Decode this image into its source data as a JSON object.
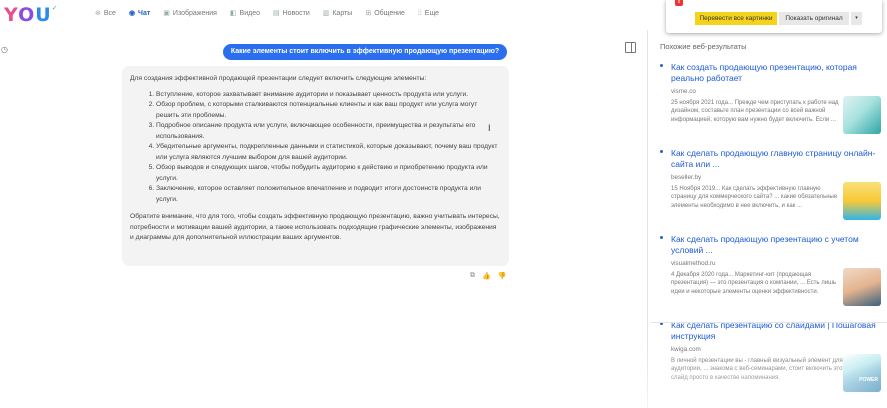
{
  "logo": {
    "text": "YOU"
  },
  "nav": [
    {
      "icon": "globe-icon",
      "glyph": "⊛",
      "label": "Все",
      "active": false
    },
    {
      "icon": "chat-icon",
      "glyph": "◉",
      "label": "Чат",
      "active": true
    },
    {
      "icon": "image-icon",
      "glyph": "▣",
      "label": "Изображения",
      "active": false
    },
    {
      "icon": "video-icon",
      "glyph": "◧",
      "label": "Видео",
      "active": false
    },
    {
      "icon": "news-icon",
      "glyph": "▤",
      "label": "Новости",
      "active": false
    },
    {
      "icon": "map-icon",
      "glyph": "▥",
      "label": "Карты",
      "active": false
    },
    {
      "icon": "community-icon",
      "glyph": "⊞",
      "label": "Общение",
      "active": false
    },
    {
      "icon": "more-icon",
      "glyph": "⁞⁞",
      "label": "Еще",
      "active": false
    }
  ],
  "translate": {
    "translate_all": "Перевести все картинки",
    "show_original": "Показать оригинал",
    "dropdown": "▾",
    "flag": "x"
  },
  "chat": {
    "question": "Какие элементы стоит включить в эффективную продающую презентацию?",
    "intro": "Для создания эффективной продающей презентации следует включить следующие элементы:",
    "items": [
      "Вступление, которое захватывает внимание аудитории и показывает ценность продукта или услуги.",
      "Обзор проблем, с которыми сталкиваются потенциальные клиенты и как ваш продукт или услуга могут решить эти проблемы.",
      "Подробное описание продукта или услуги, включающее особенности, преимущества и результаты его использования.",
      "Убедительные аргументы, подкрепленные данными и статистикой, которые доказывают, почему ваш продукт или услуга являются лучшим выбором для вашей аудитории.",
      "Обзор выводов и следующих шагов, чтобы побудить аудиторию к действию и приобретению продукта или услуги.",
      "Заключение, которое оставляет положительное впечатление и подводит итоги достоинств продукта или услуги."
    ],
    "outro": "Обратите внимание, что для того, чтобы создать эффективную продающую презентацию, важно учитывать интересы, потребности и мотивации вашей аудитории, а также использовать подходящие графические элементы, изображения и диаграммы для дополнительной иллюстрации ваших аргументов."
  },
  "feedback": {
    "copy": "⧉",
    "like": "👍",
    "dislike": "👎"
  },
  "related": {
    "heading": "Похожие веб-результаты",
    "results": [
      {
        "title": "Как создать продающую презентацию, которая реально работает",
        "domain": "visme.co",
        "snippet": "25 ноября 2021 года... Прежде чем приступать к работе над дизайном, составьте план презентации со всей важной информацией, которую вам нужно будет включить. Если ..."
      },
      {
        "title": "Как сделать продающую главную страницу онлайн-сайта или ...",
        "domain": "beseller.by",
        "snippet": "15 Ноября 2019... Как сделать эффективную главную страницу для коммерческого сайта? ... какие обязательные элементы необходимо в нее включить, и как ..."
      },
      {
        "title": "Как сделать продающую презентацию с учетом условий ...",
        "domain": "visualmethod.ru",
        "snippet": "4 Декабря 2020 года... Маркетинг-кит (продающая презентация) — это презентация о компании, ... Есть лишь идеи и некоторые элементы оценки эффективности."
      },
      {
        "title": "Как сделать презентацию со слайдами | Пошаговая инструкция",
        "domain": "kwiga.com",
        "snippet": "В личной презентации вы - главный визуальный элемент для аудитории, ... знакома с веб-семинарами, стоит включить этот слайд просто в качестве напоминания."
      }
    ],
    "thumb4_text": "POWER"
  }
}
